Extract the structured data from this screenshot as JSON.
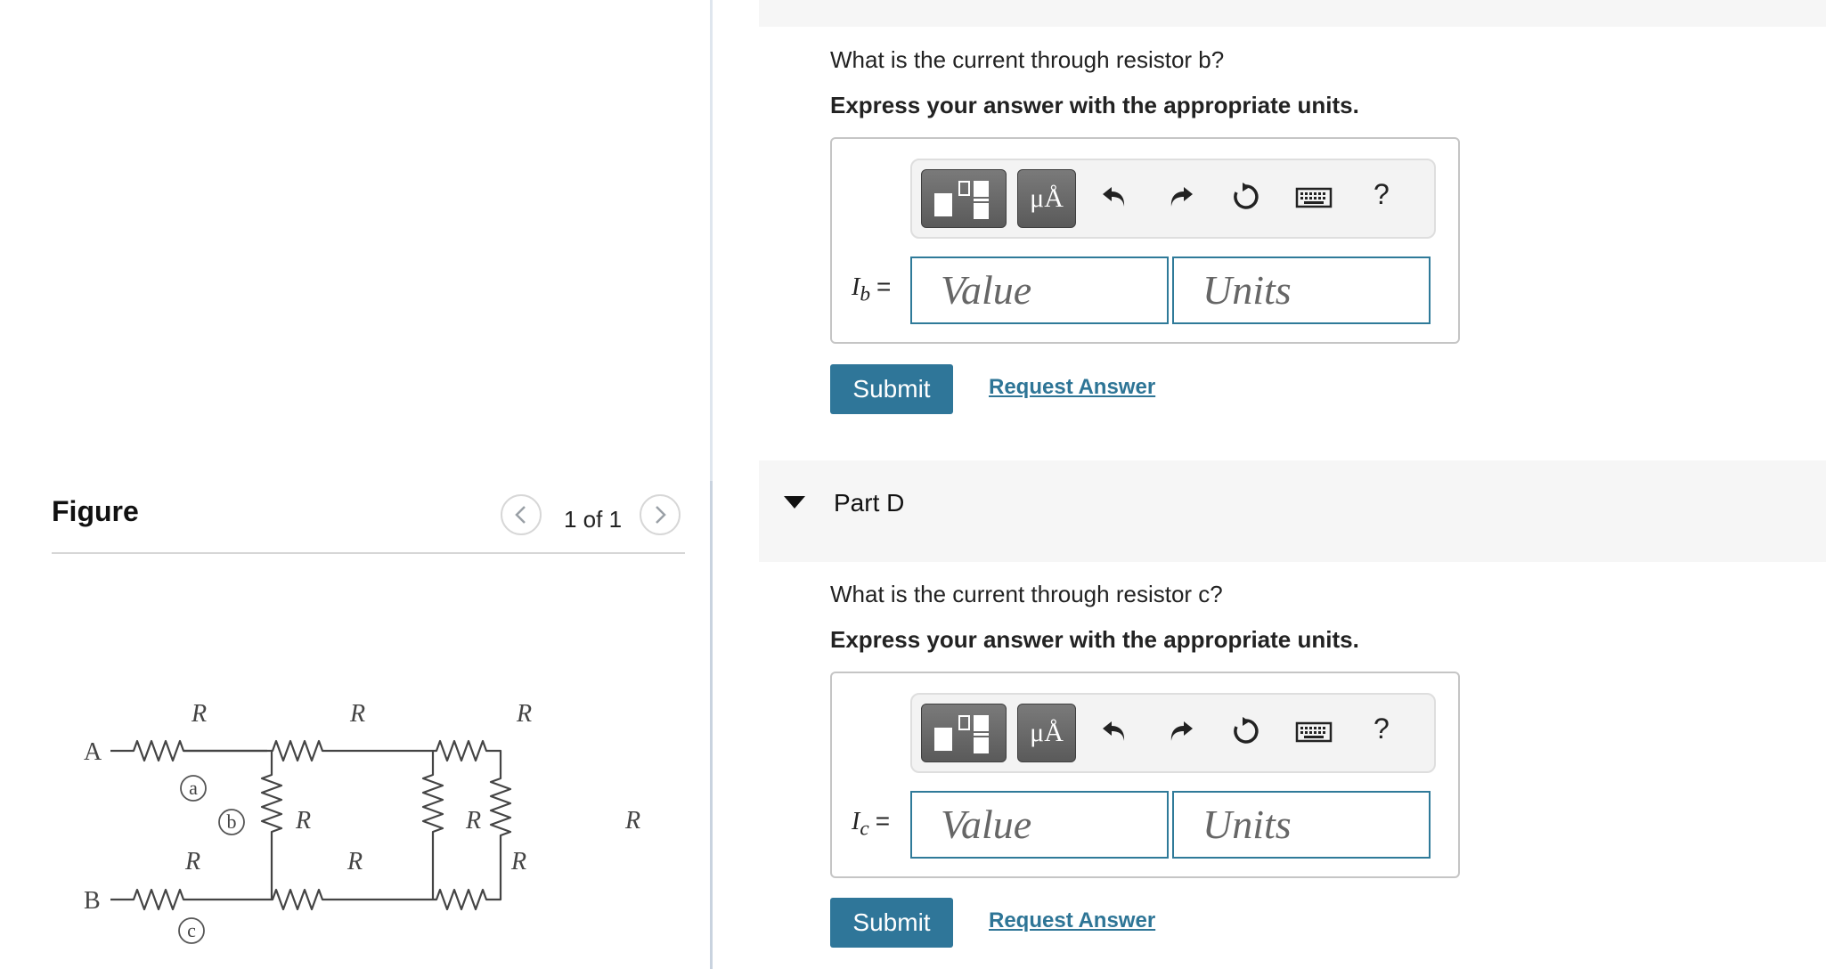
{
  "figure": {
    "title": "Figure",
    "page_count": "1 of 1",
    "circuit": {
      "node_a": "A",
      "node_b": "B",
      "resistor_label": "R",
      "tag_a": "a",
      "tag_b": "b",
      "tag_c": "c"
    }
  },
  "part_c": {
    "question": "What is the current through resistor b?",
    "instruction": "Express your answer with the appropriate units.",
    "variable": "I",
    "variable_sub": "b",
    "equals": "=",
    "value_placeholder": "Value",
    "units_placeholder": "Units",
    "unit_button": "μÅ",
    "help": "?",
    "submit": "Submit",
    "request_answer": "Request Answer"
  },
  "part_d": {
    "label": "Part D",
    "question": "What is the current through resistor c?",
    "instruction": "Express your answer with the appropriate units.",
    "variable": "I",
    "variable_sub": "c",
    "equals": "=",
    "value_placeholder": "Value",
    "units_placeholder": "Units",
    "unit_button": "μÅ",
    "help": "?",
    "submit": "Submit",
    "request_answer": "Request Answer"
  },
  "icons": {
    "prev": "chevron-left-icon",
    "next": "chevron-right-icon",
    "templates": "fraction-template-icon",
    "undo": "undo-icon",
    "redo": "redo-icon",
    "reset": "reset-icon",
    "keyboard": "keyboard-icon",
    "collapse": "caret-down-icon"
  },
  "colors": {
    "accent": "#2f7699",
    "link": "#2e7596",
    "field_border": "#2f7a99"
  }
}
